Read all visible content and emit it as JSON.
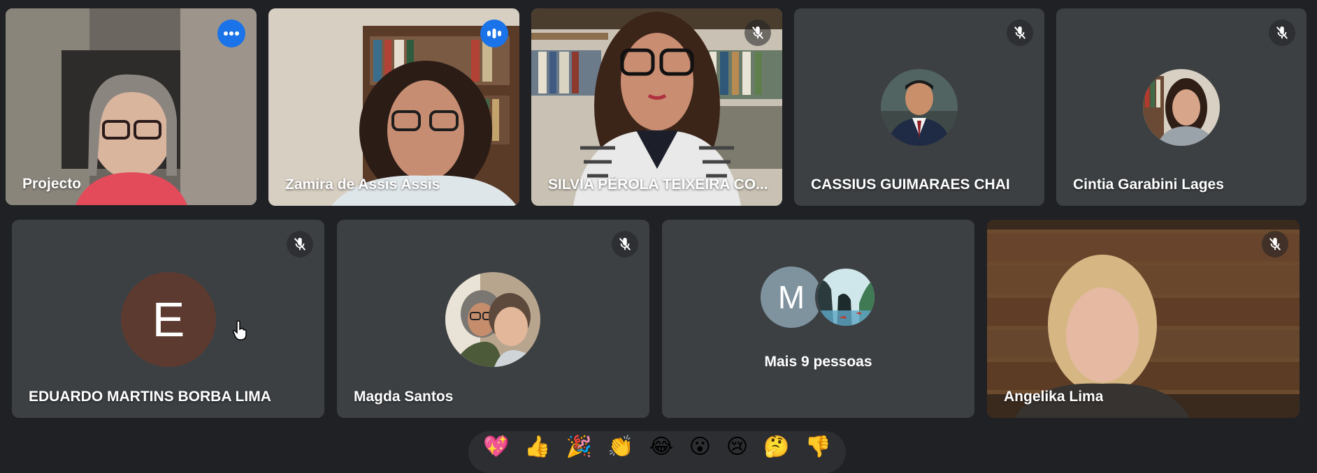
{
  "row1": [
    {
      "name": "Projecto",
      "state": "active",
      "control": "more-options-icon"
    },
    {
      "name": "Zamira de Assis Assis",
      "state": "speaking",
      "control": "audio-level-icon"
    },
    {
      "name": "SILVIA PÉROLA TEIXEIRA CO...",
      "state": "muted",
      "control": "mic-off-icon"
    },
    {
      "name": "CASSIUS GUIMARAES CHAI",
      "state": "muted",
      "control": "mic-off-icon"
    },
    {
      "name": "Cintia Garabini Lages",
      "state": "muted",
      "control": "mic-off-icon"
    }
  ],
  "row2": [
    {
      "name": "EDUARDO MARTINS BORBA LIMA",
      "avatar_letter": "E",
      "avatar_color": "#5d3a30",
      "state": "muted"
    },
    {
      "name": "Magda Santos",
      "state": "muted"
    },
    {
      "overflow_label": "Mais 9 pessoas",
      "avatar_letter": "M",
      "avatar_color": "#7f939f"
    },
    {
      "name": "Angelika Lima",
      "state": "muted"
    }
  ],
  "reactions": [
    "💖",
    "👍",
    "🎉",
    "👏",
    "😂",
    "😮",
    "😢",
    "🤔",
    "👎"
  ],
  "colors": {
    "background": "#202124",
    "tile": "#3c4043",
    "accent": "#1a73e8",
    "active_border": "#8ab4f8"
  }
}
